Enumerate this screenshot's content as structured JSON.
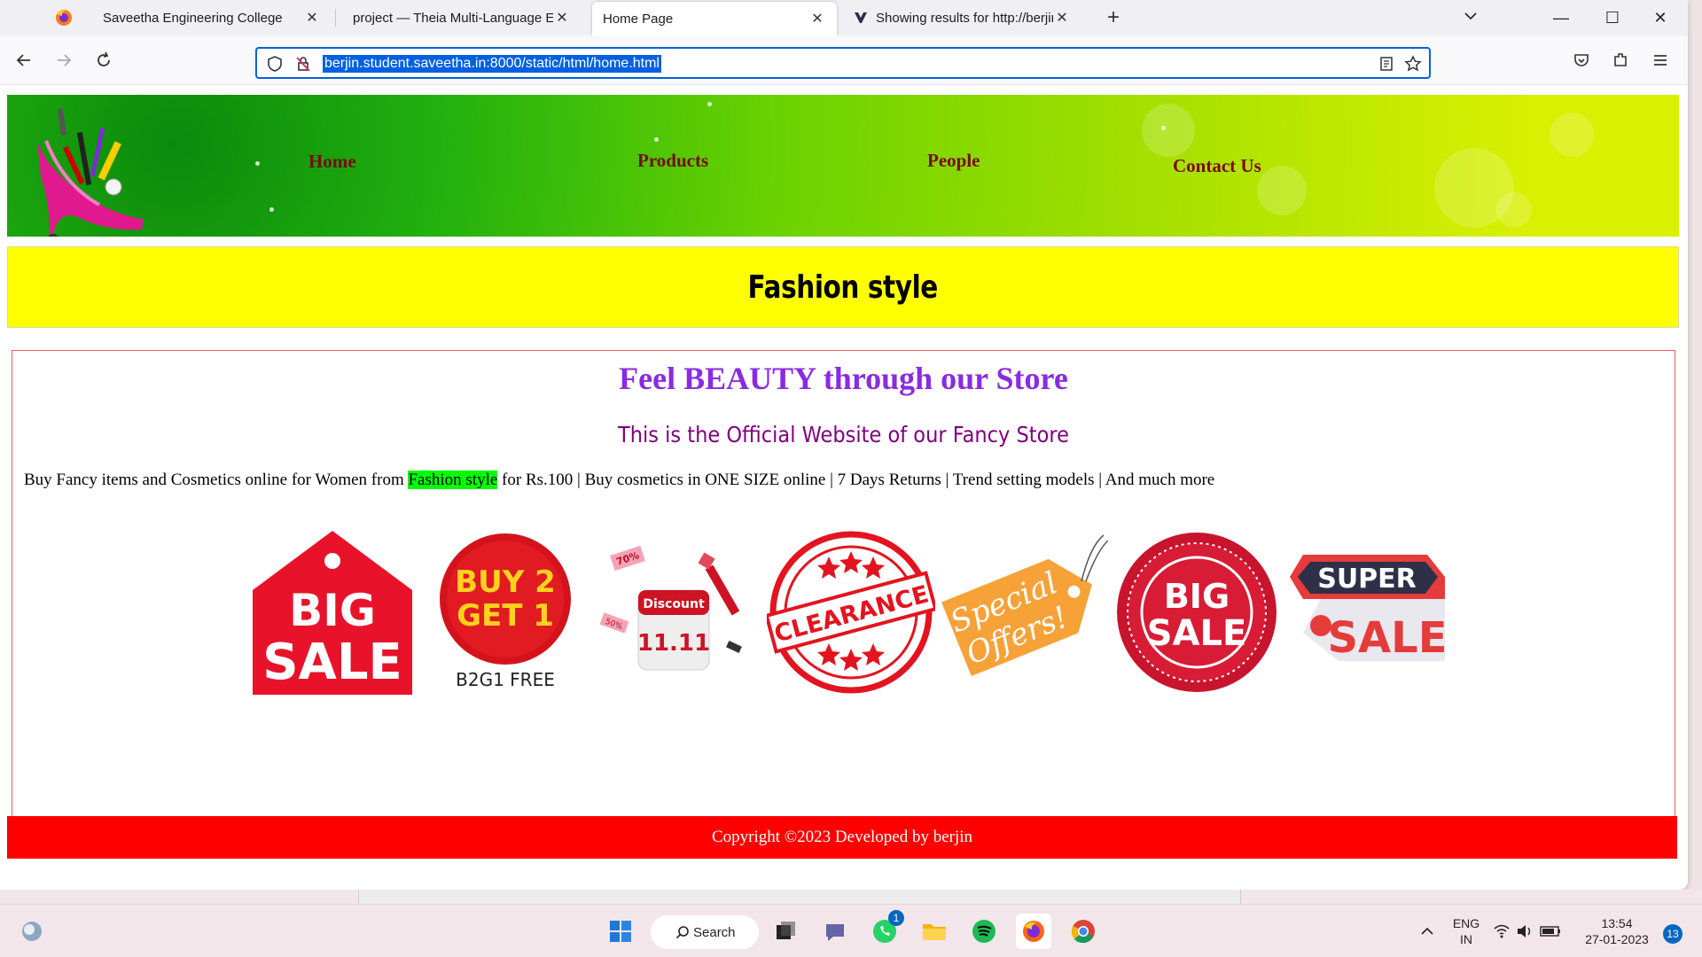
{
  "browser": {
    "tabs": [
      {
        "label": "Saveetha Engineering College",
        "active": false
      },
      {
        "label": "project — Theia Multi-Language Ex",
        "active": false
      },
      {
        "label": "Home Page",
        "active": true
      },
      {
        "label": "Showing results for http://berjin",
        "active": false
      }
    ],
    "url": "berjin.student.saveetha.in:8000/static/html/home.html",
    "window_controls": {
      "minimize": "—",
      "maximize": "☐",
      "close": "✕"
    },
    "list_tabs_icon": "chevron-down-icon",
    "new_tab": "+"
  },
  "site": {
    "nav": [
      "Home",
      "Products",
      "People",
      "Contact Us"
    ],
    "banner_title": "Fashion style",
    "heading": "Feel BEAUTY through our Store",
    "subheading": "This is the Official Website of our Fancy Store",
    "desc_before": "Buy Fancy items and Cosmetics online for Women from ",
    "desc_highlight": "Fashion style",
    "desc_after": " for Rs.100 | Buy cosmetics in ONE SIZE online | 7 Days Returns | Trend setting models | And much more",
    "sale_badges": {
      "big_sale_1": [
        "BIG",
        "SALE"
      ],
      "buy2get1": [
        "BUY 2",
        "GET 1",
        "B2G1 FREE"
      ],
      "discount": [
        "70%",
        "50%",
        "Discount",
        "11.11"
      ],
      "clearance": "CLEARANCE",
      "special_offers": [
        "Special",
        "Offers!"
      ],
      "big_sale_2": [
        "BIG",
        "SALE"
      ],
      "super_sale": [
        "SUPER",
        "SALE"
      ]
    },
    "footer": "Copyright ©2023 Developed by berjin",
    "colors": {
      "header_green": "#22b10e",
      "banner": "#ffff00",
      "heading": "#8a2be2",
      "subheading": "#800080",
      "highlight": "#00ff00",
      "footer": "#ff0000",
      "nav_text": "#7a0a0a"
    }
  },
  "taskbar": {
    "search_label": "Search",
    "whatsapp_badge": "1",
    "lang_line1": "ENG",
    "lang_line2": "IN",
    "time": "13:54",
    "date": "27-01-2023",
    "notification_count": "13"
  }
}
